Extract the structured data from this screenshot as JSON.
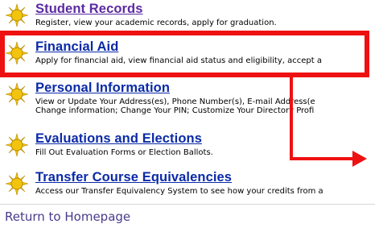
{
  "menu": [
    {
      "title": "Student Records",
      "description_lines": [
        "Register, view your academic records, apply for graduation."
      ],
      "visited": true
    },
    {
      "title": "Financial Aid",
      "description_lines": [
        "Apply for financial aid, view financial aid status and eligibility, accept a"
      ],
      "visited": false
    },
    {
      "title": "Personal Information",
      "description_lines": [
        "View or Update Your Address(es), Phone Number(s), E-mail Address(e",
        "Change information; Change Your PIN; Customize Your Directory Profi"
      ],
      "visited": false
    },
    {
      "title": "Evaluations and Elections",
      "description_lines": [
        "Fill Out Evaluation Forms or Election Ballots."
      ],
      "visited": false
    },
    {
      "title": "Transfer Course Equivalencies",
      "description_lines": [
        "Access our Transfer Equivalency System to see how your credits from a"
      ],
      "visited": false
    }
  ],
  "footer": {
    "home_link": "Return to Homepage"
  },
  "colors": {
    "link": "#0a2aa8",
    "visited_link": "#5b2aa0",
    "highlight": "#ee1111",
    "sun_icon": "#f2c40e"
  },
  "annotations": {
    "highlighted_item": "Financial Aid",
    "arrow": "points right toward page edge"
  }
}
